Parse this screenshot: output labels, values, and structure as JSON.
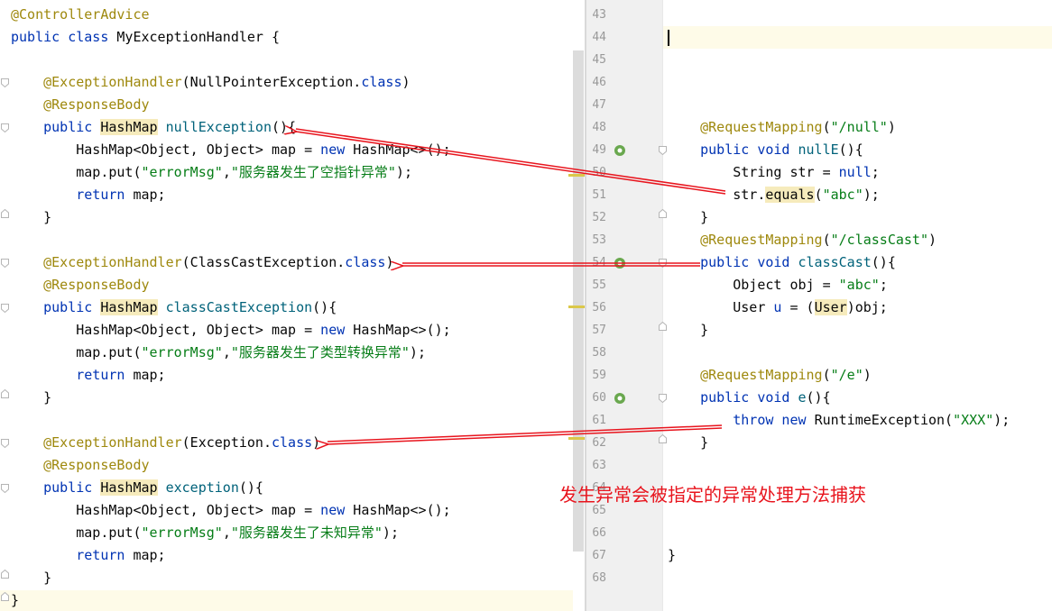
{
  "left_editor": {
    "lines": [
      [
        [
          "@ControllerAdvice",
          "ann"
        ]
      ],
      [
        [
          "public class ",
          "kw"
        ],
        [
          "MyExceptionHandler {",
          ""
        ]
      ],
      [],
      [
        [
          "    ",
          ""
        ],
        [
          "@ExceptionHandler",
          "ann"
        ],
        [
          "(NullPointerException.",
          ""
        ],
        [
          "class",
          "kw"
        ],
        [
          ")",
          ""
        ]
      ],
      [
        [
          "    ",
          ""
        ],
        [
          "@ResponseBody",
          "ann"
        ]
      ],
      [
        [
          "    ",
          ""
        ],
        [
          "public ",
          "kw"
        ],
        [
          "HashMap",
          "hl"
        ],
        [
          " ",
          ""
        ],
        [
          "nullException",
          "fn"
        ],
        [
          "(){",
          ""
        ]
      ],
      [
        [
          "        HashMap<Object, Object> map = ",
          ""
        ],
        [
          "new ",
          "kw"
        ],
        [
          "HashMap<>();",
          ""
        ]
      ],
      [
        [
          "        map.put(",
          ""
        ],
        [
          "\"errorMsg\"",
          "str"
        ],
        [
          ",",
          ""
        ],
        [
          "\"服务器发生了空指针异常\"",
          "str"
        ],
        [
          ");",
          ""
        ]
      ],
      [
        [
          "        ",
          ""
        ],
        [
          "return ",
          "kw"
        ],
        [
          "map;",
          ""
        ]
      ],
      [
        [
          "    }",
          ""
        ]
      ],
      [],
      [
        [
          "    ",
          ""
        ],
        [
          "@ExceptionHandler",
          "ann"
        ],
        [
          "(ClassCastException.",
          ""
        ],
        [
          "class",
          "kw"
        ],
        [
          ")",
          ""
        ]
      ],
      [
        [
          "    ",
          ""
        ],
        [
          "@ResponseBody",
          "ann"
        ]
      ],
      [
        [
          "    ",
          ""
        ],
        [
          "public ",
          "kw"
        ],
        [
          "HashMap",
          "hl"
        ],
        [
          " ",
          ""
        ],
        [
          "classCastException",
          "fn"
        ],
        [
          "(){",
          ""
        ]
      ],
      [
        [
          "        HashMap<Object, Object> map = ",
          ""
        ],
        [
          "new ",
          "kw"
        ],
        [
          "HashMap<>();",
          ""
        ]
      ],
      [
        [
          "        map.put(",
          ""
        ],
        [
          "\"errorMsg\"",
          "str"
        ],
        [
          ",",
          ""
        ],
        [
          "\"服务器发生了类型转换异常\"",
          "str"
        ],
        [
          ");",
          ""
        ]
      ],
      [
        [
          "        ",
          ""
        ],
        [
          "return ",
          "kw"
        ],
        [
          "map;",
          ""
        ]
      ],
      [
        [
          "    }",
          ""
        ]
      ],
      [],
      [
        [
          "    ",
          ""
        ],
        [
          "@ExceptionHandler",
          "ann"
        ],
        [
          "(Exception.",
          ""
        ],
        [
          "class",
          "kw"
        ],
        [
          ")",
          ""
        ]
      ],
      [
        [
          "    ",
          ""
        ],
        [
          "@ResponseBody",
          "ann"
        ]
      ],
      [
        [
          "    ",
          ""
        ],
        [
          "public ",
          "kw"
        ],
        [
          "HashMap",
          "hl"
        ],
        [
          " ",
          ""
        ],
        [
          "exception",
          "fn"
        ],
        [
          "(){",
          ""
        ]
      ],
      [
        [
          "        HashMap<Object, Object> map = ",
          ""
        ],
        [
          "new ",
          "kw"
        ],
        [
          "HashMap<>();",
          ""
        ]
      ],
      [
        [
          "        map.put(",
          ""
        ],
        [
          "\"errorMsg\"",
          "str"
        ],
        [
          ",",
          ""
        ],
        [
          "\"服务器发生了未知异常\"",
          "str"
        ],
        [
          ");",
          ""
        ]
      ],
      [
        [
          "        ",
          ""
        ],
        [
          "return ",
          "kw"
        ],
        [
          "map;",
          ""
        ]
      ],
      [
        [
          "    }",
          ""
        ]
      ],
      [
        [
          "}",
          ""
        ]
      ]
    ]
  },
  "right_editor": {
    "line_numbers": [
      "43",
      "44",
      "45",
      "46",
      "47",
      "48",
      "49",
      "50",
      "51",
      "52",
      "53",
      "54",
      "55",
      "56",
      "57",
      "58",
      "59",
      "60",
      "61",
      "62",
      "63",
      "64",
      "65",
      "66",
      "67",
      "68"
    ],
    "lines": [
      [],
      [],
      [],
      [],
      [],
      [
        [
          "    ",
          ""
        ],
        [
          "@RequestMapping",
          "ann"
        ],
        [
          "(",
          ""
        ],
        [
          "\"/null\"",
          "str"
        ],
        [
          ")",
          ""
        ]
      ],
      [
        [
          "    ",
          ""
        ],
        [
          "public void ",
          "kw"
        ],
        [
          "nullE",
          "fn"
        ],
        [
          "(){",
          ""
        ]
      ],
      [
        [
          "        String str = ",
          ""
        ],
        [
          "null",
          "kw"
        ],
        [
          ";",
          ""
        ]
      ],
      [
        [
          "        str.",
          ""
        ],
        [
          "equals",
          "hl"
        ],
        [
          "(",
          ""
        ],
        [
          "\"abc\"",
          "str"
        ],
        [
          ");",
          ""
        ]
      ],
      [
        [
          "    }",
          ""
        ]
      ],
      [
        [
          "    ",
          ""
        ],
        [
          "@RequestMapping",
          "ann"
        ],
        [
          "(",
          ""
        ],
        [
          "\"/classCast\"",
          "str"
        ],
        [
          ")",
          ""
        ]
      ],
      [
        [
          "    ",
          ""
        ],
        [
          "public void ",
          "kw"
        ],
        [
          "classCast",
          "fn"
        ],
        [
          "(){",
          ""
        ]
      ],
      [
        [
          "        Object obj = ",
          ""
        ],
        [
          "\"abc\"",
          "str"
        ],
        [
          ";",
          ""
        ]
      ],
      [
        [
          "        User ",
          ""
        ],
        [
          "u",
          "kw"
        ],
        [
          " = (",
          ""
        ],
        [
          "User",
          "hl"
        ],
        [
          ")obj;",
          ""
        ]
      ],
      [
        [
          "    }",
          ""
        ]
      ],
      [],
      [
        [
          "    ",
          ""
        ],
        [
          "@RequestMapping",
          "ann"
        ],
        [
          "(",
          ""
        ],
        [
          "\"/e\"",
          "str"
        ],
        [
          ")",
          ""
        ]
      ],
      [
        [
          "    ",
          ""
        ],
        [
          "public void ",
          "kw"
        ],
        [
          "e",
          "fn"
        ],
        [
          "(){",
          ""
        ]
      ],
      [
        [
          "        ",
          ""
        ],
        [
          "throw new ",
          "kw"
        ],
        [
          "RuntimeException(",
          ""
        ],
        [
          "\"XXX\"",
          "str"
        ],
        [
          ");",
          ""
        ]
      ],
      [
        [
          "    }",
          ""
        ]
      ],
      [],
      [],
      [],
      [],
      [
        [
          "}",
          ""
        ]
      ],
      []
    ]
  },
  "annotation_note": "发生异常会被指定的异常处理方法捕获",
  "colors": {
    "keyword": "#0033b3",
    "annotation": "#9e880d",
    "string": "#067d17",
    "method": "#00627a",
    "usage_highlight": "#f6ebbc",
    "arrow": "#e8141d"
  }
}
